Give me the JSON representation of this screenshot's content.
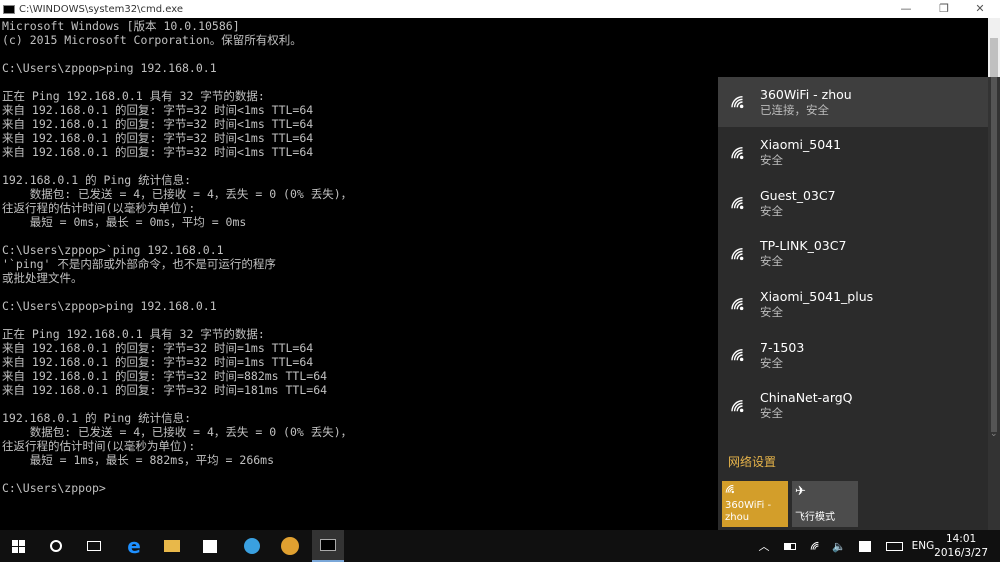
{
  "window": {
    "title": "C:\\WINDOWS\\system32\\cmd.exe",
    "minimize": "—",
    "maximize": "❐",
    "close": "✕"
  },
  "console": {
    "lines": [
      "Microsoft Windows [版本 10.0.10586]",
      "(c) 2015 Microsoft Corporation。保留所有权利。",
      "",
      "C:\\Users\\zppop>ping 192.168.0.1",
      "",
      "正在 Ping 192.168.0.1 具有 32 字节的数据:",
      "来自 192.168.0.1 的回复: 字节=32 时间<1ms TTL=64",
      "来自 192.168.0.1 的回复: 字节=32 时间<1ms TTL=64",
      "来自 192.168.0.1 的回复: 字节=32 时间<1ms TTL=64",
      "来自 192.168.0.1 的回复: 字节=32 时间<1ms TTL=64",
      "",
      "192.168.0.1 的 Ping 统计信息:",
      "    数据包: 已发送 = 4，已接收 = 4，丢失 = 0 (0% 丢失)，",
      "往返行程的估计时间(以毫秒为单位):",
      "    最短 = 0ms，最长 = 0ms，平均 = 0ms",
      "",
      "C:\\Users\\zppop>`ping 192.168.0.1",
      "'`ping' 不是内部或外部命令，也不是可运行的程序",
      "或批处理文件。",
      "",
      "C:\\Users\\zppop>ping 192.168.0.1",
      "",
      "正在 Ping 192.168.0.1 具有 32 字节的数据:",
      "来自 192.168.0.1 的回复: 字节=32 时间=1ms TTL=64",
      "来自 192.168.0.1 的回复: 字节=32 时间=1ms TTL=64",
      "来自 192.168.0.1 的回复: 字节=32 时间=882ms TTL=64",
      "来自 192.168.0.1 的回复: 字节=32 时间=181ms TTL=64",
      "",
      "192.168.0.1 的 Ping 统计信息:",
      "    数据包: 已发送 = 4，已接收 = 4，丢失 = 0 (0% 丢失)，",
      "往返行程的估计时间(以毫秒为单位):",
      "    最短 = 1ms，最长 = 882ms，平均 = 266ms",
      "",
      "C:\\Users\\zppop>"
    ]
  },
  "wifi": {
    "networks": [
      {
        "name": "360WiFi - zhou",
        "status": "已连接，安全"
      },
      {
        "name": "Xiaomi_5041",
        "status": "安全"
      },
      {
        "name": "Guest_03C7",
        "status": "安全"
      },
      {
        "name": "TP-LINK_03C7",
        "status": "安全"
      },
      {
        "name": "Xiaomi_5041_plus",
        "status": "安全"
      },
      {
        "name": "7-1503",
        "status": "安全"
      },
      {
        "name": "ChinaNet-argQ",
        "status": "安全"
      }
    ],
    "network_settings": "网络设置",
    "tiles": [
      {
        "label": "360WiFi - zhou",
        "color": "#d39e2a"
      },
      {
        "label": "飞行模式",
        "color": "#4c4c4c"
      }
    ]
  },
  "taskbar": {
    "language": "ENG",
    "time": "14:01",
    "date": "2016/3/27"
  }
}
